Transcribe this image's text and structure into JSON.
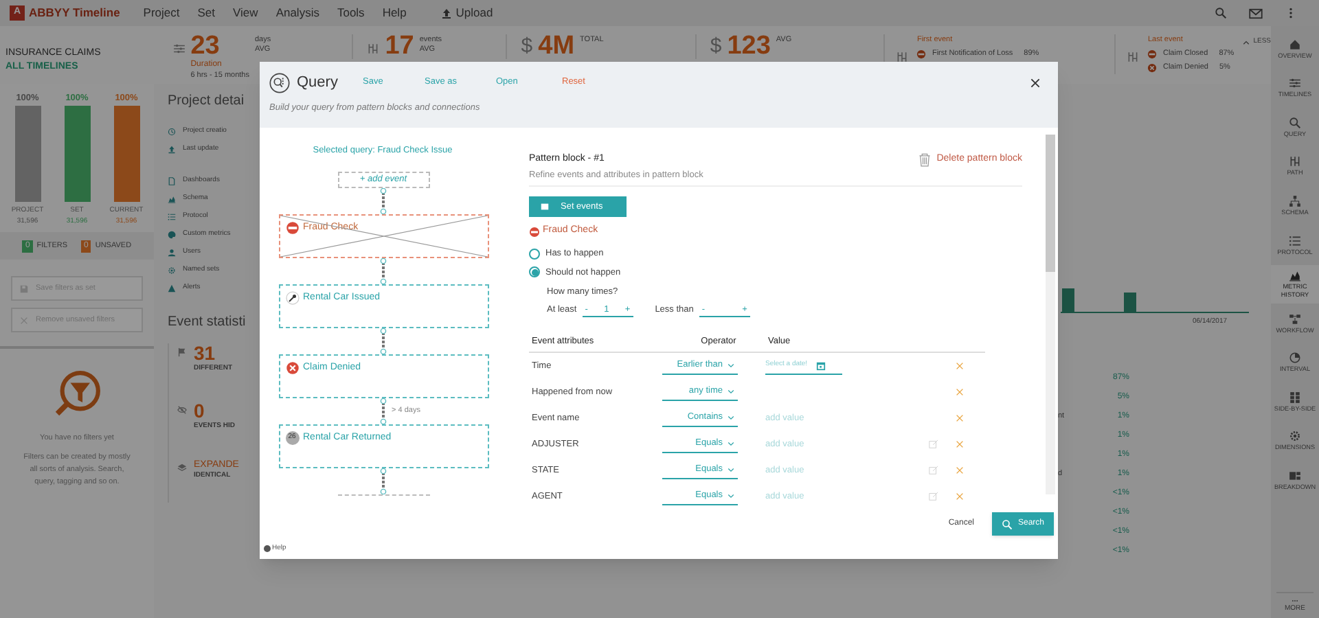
{
  "app": {
    "logo_mark": "A",
    "logo": "ABBYY Timeline",
    "menu": [
      "Project",
      "Set",
      "View",
      "Analysis",
      "Tools",
      "Help"
    ],
    "upload": "Upload"
  },
  "project": {
    "title": "INSURANCE CLAIMS",
    "subtitle": "ALL TIMELINES"
  },
  "stats": [
    {
      "kind": "duration",
      "value": "23",
      "unit": "days",
      "qualifier": "AVG",
      "label": "Duration",
      "range": "6 hrs - 15 months"
    },
    {
      "kind": "count",
      "value": "17",
      "unit": "events",
      "qualifier": "AVG"
    },
    {
      "kind": "money",
      "symbol": "$",
      "value": "4M",
      "qualifier": "TOTAL"
    },
    {
      "kind": "money",
      "symbol": "$",
      "value": "123",
      "qualifier": "AVG"
    }
  ],
  "first_event": {
    "title": "First event",
    "items": [
      {
        "name": "First Notification of Loss",
        "share": "89%"
      }
    ]
  },
  "last_event": {
    "title": "Last event",
    "items": [
      {
        "name": "Claim Closed",
        "share": "87%"
      },
      {
        "name": "Claim Denied",
        "share": "5%"
      }
    ]
  },
  "less": "LESS",
  "bars": [
    {
      "percent": "100%",
      "label": "PROJECT",
      "count": "31,596",
      "level": 1
    },
    {
      "percent": "100%",
      "label": "SET",
      "count": "31,596",
      "level": 1
    },
    {
      "percent": "100%",
      "label": "CURRENT",
      "count": "31,596",
      "level": 1
    }
  ],
  "counters": [
    {
      "count": "0",
      "label": "FILTERS"
    },
    {
      "count": "0",
      "label": "UNSAVED"
    }
  ],
  "filter_buttons": [
    "Save filters as set",
    "Remove unsaved filters"
  ],
  "empty": {
    "title": "You have no filters yet",
    "text": "Filters can be created by mostly all sorts of analysis. Search, query, tagging and so on."
  },
  "details": {
    "title": "Project detai",
    "meta": [
      "Project creatio",
      "Last update"
    ],
    "links": [
      "Dashboards",
      "Schema",
      "Protocol",
      "Custom metrics",
      "Users",
      "Named sets",
      "Alerts"
    ]
  },
  "event_stats": {
    "title": "Event statisti",
    "items": [
      {
        "value": "31",
        "label": "DIFFERENT"
      },
      {
        "value": "0",
        "label": "EVENTS HID"
      },
      {
        "value": "EXPANDE",
        "label": "IDENTICAL"
      }
    ]
  },
  "behind_right": {
    "date": "06/14/2017",
    "rows": [
      {
        "share": "87%"
      },
      {
        "share": "5%"
      },
      {
        "text": "nt",
        "share": "1%"
      },
      {
        "share": "1%"
      },
      {
        "share": "1%"
      },
      {
        "text": "d",
        "share": "1%"
      },
      {
        "share": "<1%"
      },
      {
        "share": "<1%"
      },
      {
        "share": "<1%"
      },
      {
        "share": "<1%"
      }
    ]
  },
  "nav": [
    {
      "label": "OVERVIEW",
      "selected": false
    },
    {
      "label": "TIMELINES",
      "selected": false
    },
    {
      "label": "QUERY",
      "selected": false
    },
    {
      "label": "PATH",
      "selected": false
    },
    {
      "label": "SCHEMA",
      "selected": false
    },
    {
      "label": "PROTOCOL",
      "selected": false
    },
    {
      "label": "METRIC HISTORY",
      "selected": true
    },
    {
      "label": "WORKFLOW",
      "selected": false
    },
    {
      "label": "INTERVAL",
      "selected": false
    },
    {
      "label": "SIDE-BY-SIDE",
      "selected": false
    },
    {
      "label": "DIMENSIONS",
      "selected": false
    },
    {
      "label": "BREAKDOWN",
      "selected": false
    }
  ],
  "more": "MORE",
  "query": {
    "title": "Query",
    "actions": [
      {
        "label": "Save",
        "kind": "normal"
      },
      {
        "label": "Save as",
        "kind": "normal"
      },
      {
        "label": "Open",
        "kind": "normal"
      },
      {
        "label": "Reset",
        "kind": "danger"
      }
    ],
    "subtitle": "Build your query from pattern blocks and connections",
    "selected_query": "Selected query: Fraud Check Issue",
    "add_event": "+ add event",
    "blocks": [
      {
        "kind": "negated",
        "label": "Fraud Check"
      },
      {
        "kind": "normal",
        "label": "Rental Car Issued"
      },
      {
        "kind": "normal",
        "label": "Claim Denied"
      },
      {
        "kind": "normal",
        "badge": "26",
        "label": "Rental Car Returned",
        "connector_label": "> 4 days"
      },
      {
        "kind": "partial"
      }
    ],
    "help": "Help",
    "pattern": {
      "title": "Pattern block - #1",
      "subtitle": "Refine events and attributes in pattern block",
      "delete": "Delete pattern block",
      "set_events": "Set events",
      "event": "Fraud Check",
      "radios": [
        {
          "label": "Has to happen",
          "selected": false
        },
        {
          "label": "Should not happen",
          "selected": true
        }
      ],
      "times_label": "How many times?",
      "times": [
        {
          "label": "At least",
          "dec": "-",
          "value": "1",
          "inc": "+"
        },
        {
          "label": "Less than",
          "dec": "-",
          "inc": "+"
        }
      ],
      "columns": [
        "Event attributes",
        "Operator",
        "Value"
      ],
      "rows": [
        {
          "attribute": "Time",
          "operator": "Earlier than",
          "kind": "date",
          "placeholder": "Select a date!"
        },
        {
          "attribute": "Happened from now",
          "operator": "any time",
          "kind": "none"
        },
        {
          "attribute": "Event name",
          "operator": "Contains",
          "kind": "text",
          "placeholder": "add value"
        },
        {
          "attribute": "ADJUSTER",
          "operator": "Equals",
          "kind": "text-edit",
          "placeholder": "add value"
        },
        {
          "attribute": "STATE",
          "operator": "Equals",
          "kind": "text-edit",
          "placeholder": "add value"
        },
        {
          "attribute": "AGENT",
          "operator": "Equals",
          "kind": "text-edit",
          "placeholder": "add value"
        }
      ]
    },
    "cancel": "Cancel",
    "search": "Search"
  }
}
